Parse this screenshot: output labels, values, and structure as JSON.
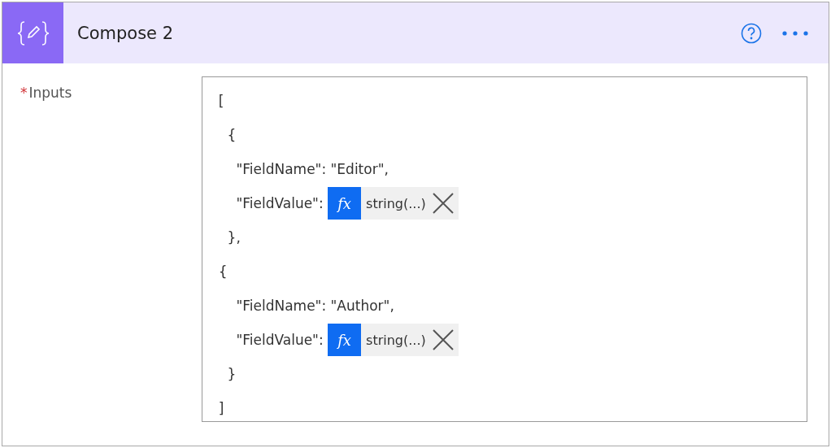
{
  "header": {
    "title": "Compose 2"
  },
  "field": {
    "label": "Inputs",
    "required_mark": "*",
    "required": true,
    "lines": [
      {
        "kind": "text",
        "text": "["
      },
      {
        "kind": "text",
        "text": "  {"
      },
      {
        "kind": "text",
        "text": "    \"FieldName\": \"Editor\","
      },
      {
        "kind": "token",
        "text": "    \"FieldValue\": ",
        "token_icon": "fx",
        "token_text": "string(...)"
      },
      {
        "kind": "text",
        "text": "  },"
      },
      {
        "kind": "text",
        "text": "{"
      },
      {
        "kind": "text",
        "text": "    \"FieldName\": \"Author\","
      },
      {
        "kind": "token",
        "text": "    \"FieldValue\": ",
        "token_icon": "fx",
        "token_text": "string(...)"
      },
      {
        "kind": "text",
        "text": "  }"
      },
      {
        "kind": "text",
        "text": "]"
      }
    ]
  }
}
